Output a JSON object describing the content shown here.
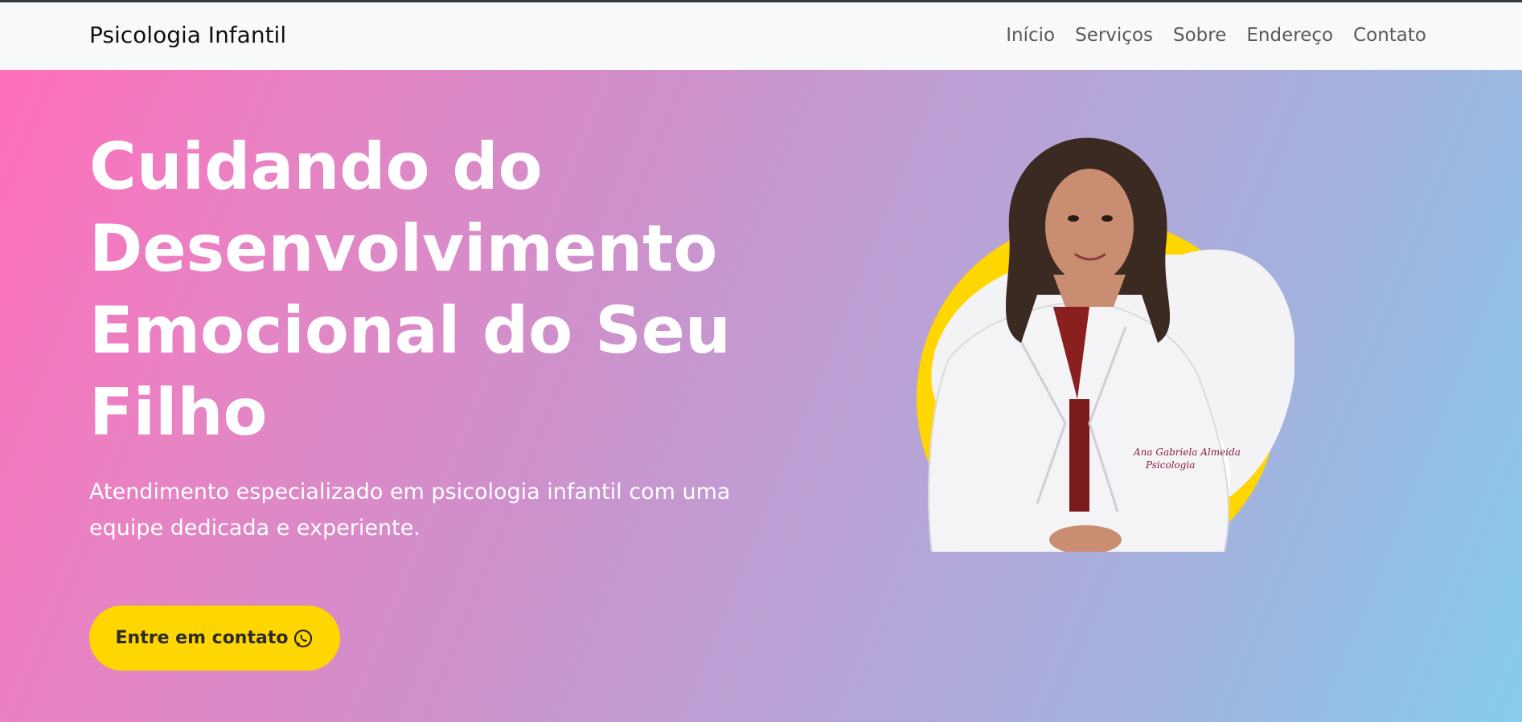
{
  "navbar": {
    "brand": "Psicologia Infantil",
    "links": [
      "Início",
      "Serviços",
      "Sobre",
      "Endereço",
      "Contato"
    ]
  },
  "hero": {
    "headline": "Cuidando do Desenvolvimento Emocional do Seu Filho",
    "subtitle": "Atendimento especializado em psicologia infantil com uma equipe dedicada e experiente.",
    "cta_label": "Entre em contato",
    "cta_icon": "whatsapp-icon",
    "photo": {
      "icon": "psychologist-portrait",
      "coat_text_line1": "Ana Gabriela Almeida",
      "coat_text_line2": "Psicologia"
    }
  },
  "colors": {
    "gradient_start": "#ff6fbb",
    "gradient_end": "#87ccec",
    "accent_yellow": "#ffd600",
    "navbar_bg": "#f8f9fa"
  }
}
